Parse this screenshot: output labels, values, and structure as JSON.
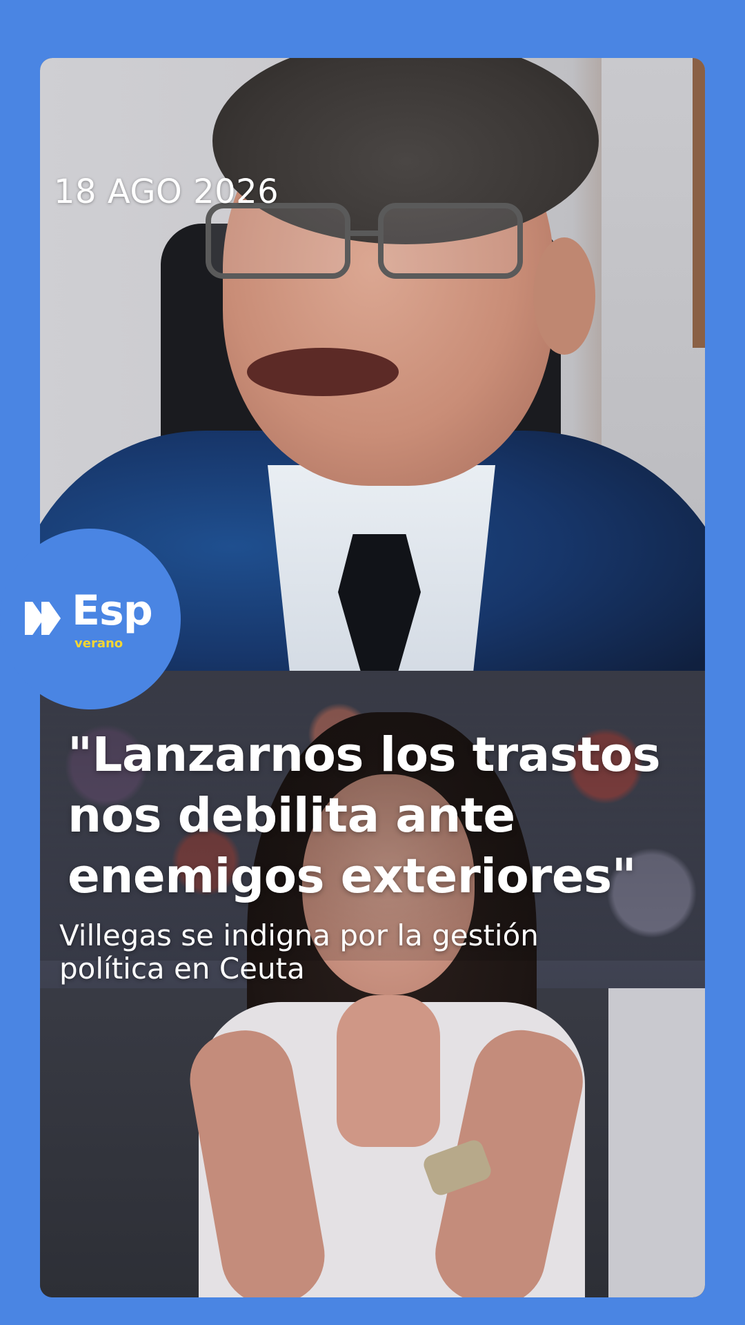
{
  "story": {
    "date": "18 AGO 2026",
    "headline": "\"Lanzarnos los trastos nos debilita ante enemigos exteriores\"",
    "subheadline": "Villegas se indigna por la gestión política en Ceuta"
  },
  "logo": {
    "brand": "Esp",
    "edition": "verano",
    "icon": "double-play-icon"
  },
  "colors": {
    "background": "#4a85e3",
    "accent": "#f4d632",
    "text": "#ffffff"
  }
}
